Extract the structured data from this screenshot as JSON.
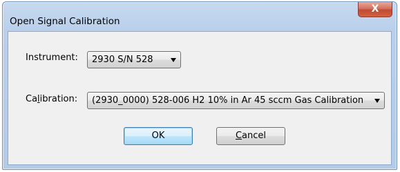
{
  "window": {
    "title": "Open Signal Calibration",
    "close_glyph": "X"
  },
  "form": {
    "instrument": {
      "label": "Instrument:",
      "value": "2930 S/N 528"
    },
    "calibration": {
      "label_prefix": "Ca",
      "label_accel": "l",
      "label_suffix": "ibration:",
      "value": "(2930_0000) 528-006 H2 10% in Ar 45 sccm Gas Calibration"
    }
  },
  "buttons": {
    "ok": "OK",
    "cancel_accel": "C",
    "cancel_rest": "ancel"
  },
  "icons": {
    "close": "close-icon",
    "dropdown": "chevron-down-icon"
  },
  "colors": {
    "titlebar": "#b9cfea",
    "client": "#f0f0f0",
    "close_button": "#c24a33",
    "default_button": "#bee6fd"
  }
}
